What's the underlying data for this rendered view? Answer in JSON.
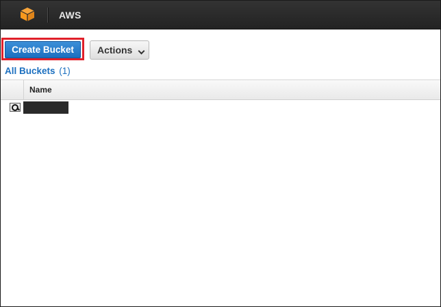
{
  "header": {
    "brand": "AWS",
    "logo_icon": "aws-cube-icon",
    "logo_color": "#f7981d"
  },
  "toolbar": {
    "create_bucket_label": "Create Bucket",
    "actions_label": "Actions",
    "highlight_color": "#e0202a",
    "primary_color": "#1b6fbf"
  },
  "buckets": {
    "heading": "All Buckets",
    "count": "(1)",
    "columns": [
      "Name"
    ],
    "rows": [
      {
        "name": "",
        "icon": "magnifier-icon"
      }
    ]
  }
}
